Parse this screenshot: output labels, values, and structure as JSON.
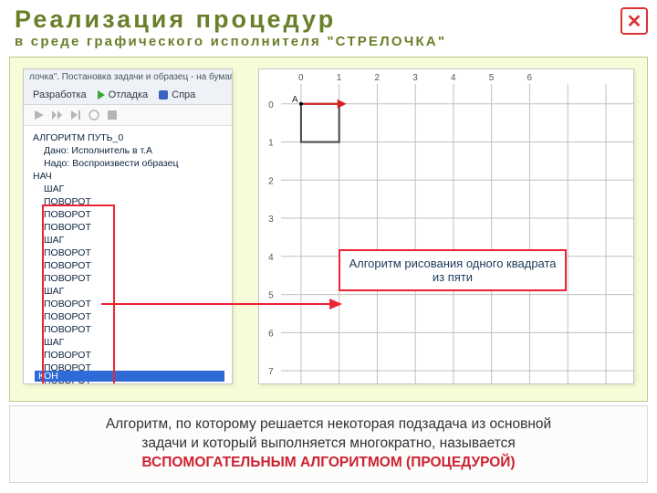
{
  "header": {
    "title": "Реализация процедур",
    "subtitle": "в среде графического исполнителя \"СТРЕЛОЧКА\""
  },
  "closeLabel": "✕",
  "leftPanel": {
    "windowTitle": "лочка\". Постановка задачи и образец - на бумаге",
    "tabs": {
      "dev": "Разработка",
      "debug": "Отладка",
      "help": "Спра"
    },
    "code": {
      "l1": "АЛГОРИТМ ПУТЬ_0",
      "l2": "Дано: Исполнитель в т.А",
      "l3": "Надо: Воспроизвести образец",
      "l4": "НАЧ",
      "steps": [
        "ШАГ",
        "ПОВОРОТ",
        "ПОВОРОТ",
        "ПОВОРОТ",
        "ШАГ",
        "ПОВОРОТ",
        "ПОВОРОТ",
        "ПОВОРОТ",
        "ШАГ",
        "ПОВОРОТ",
        "ПОВОРОТ",
        "ПОВОРОТ",
        "ШАГ",
        "ПОВОРОТ",
        "ПОВОРОТ",
        "ПОВОРОТ"
      ],
      "end": "КОН"
    }
  },
  "grid": {
    "xLabels": [
      "0",
      "1",
      "2",
      "3",
      "4",
      "5",
      "6"
    ],
    "yLabels": [
      "0",
      "1",
      "2",
      "3",
      "4",
      "5",
      "6",
      "7"
    ],
    "pointA": "A"
  },
  "callout": "Алгоритм рисования одного квадрата из пяти",
  "footer": {
    "line1": "Алгоритм, по которому решается некоторая подзадача из основной",
    "line2": "задачи и который выполняется многократно, называется",
    "line3": "ВСПОМОГАТЕЛЬНЫМ АЛГОРИТМОМ (ПРОЦЕДУРОЙ)"
  }
}
